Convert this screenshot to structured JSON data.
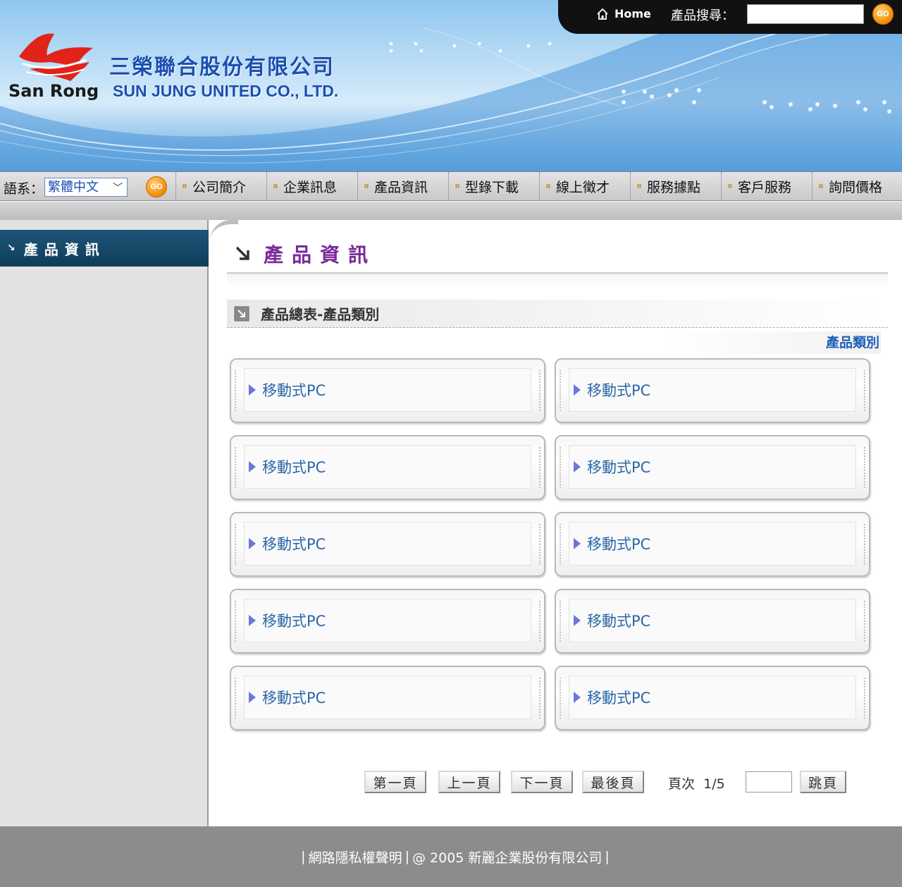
{
  "header": {
    "brand_en": "San Rong",
    "company_zh": "三榮聯合股份有限公司",
    "company_en": "SUN JUNG UNITED CO., LTD.",
    "home_label": "Home",
    "search_label": "產品搜尋：",
    "search_value": "",
    "go_label": "GO",
    "colors": {
      "sky": "#8fc6ef",
      "brand_red": "#e0241a",
      "brand_blue": "#1c4fb0"
    }
  },
  "nav": {
    "lang_label": "語系：",
    "lang_selected": "繁體中文",
    "go_label": "GO",
    "items": [
      {
        "label": "公司簡介"
      },
      {
        "label": "企業訊息"
      },
      {
        "label": "產品資訊"
      },
      {
        "label": "型錄下載"
      },
      {
        "label": "線上徵才"
      },
      {
        "label": "服務據點"
      },
      {
        "label": "客戶服務"
      },
      {
        "label": "詢問價格"
      }
    ]
  },
  "sidebar": {
    "title": "產品資訊"
  },
  "main": {
    "page_title": "產品資訊",
    "section_title": "產品總表-產品類別",
    "category_link": "產品類別",
    "cards": [
      {
        "label": "移動式PC"
      },
      {
        "label": "移動式PC"
      },
      {
        "label": "移動式PC"
      },
      {
        "label": "移動式PC"
      },
      {
        "label": "移動式PC"
      },
      {
        "label": "移動式PC"
      },
      {
        "label": "移動式PC"
      },
      {
        "label": "移動式PC"
      },
      {
        "label": "移動式PC"
      },
      {
        "label": "移動式PC"
      }
    ]
  },
  "pager": {
    "first": "第一頁",
    "prev": "上一頁",
    "next": "下一頁",
    "last": "最後頁",
    "page_label": "頁次",
    "page_value": "1/5",
    "jump_value": "",
    "jump": "跳頁"
  },
  "footer": {
    "privacy": "網路隱私權聲明",
    "copyright": "@ 2005 新麗企業股份有限公司",
    "bar": "|"
  }
}
